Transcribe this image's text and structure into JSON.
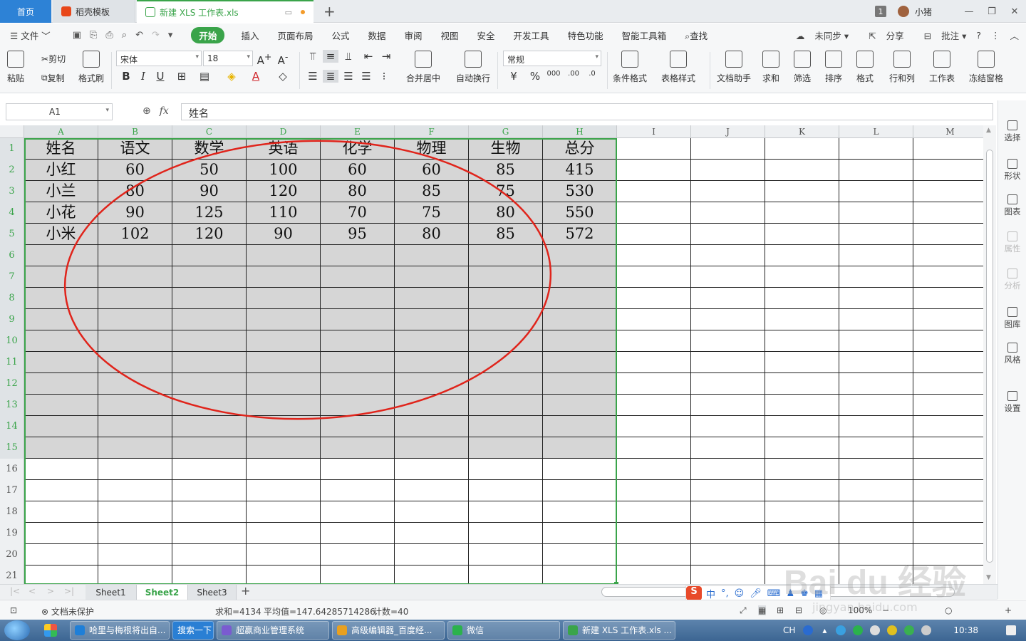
{
  "titlebar": {
    "tabs": [
      {
        "label": "首页"
      },
      {
        "label": "稻壳模板"
      },
      {
        "label": "新建 XLS 工作表.xls"
      }
    ],
    "window_count": "1",
    "user_name": "小猪"
  },
  "menubar": {
    "file_label": "文件",
    "items": [
      "开始",
      "插入",
      "页面布局",
      "公式",
      "数据",
      "审阅",
      "视图",
      "安全",
      "开发工具",
      "特色功能",
      "智能工具箱"
    ],
    "search_label": "查找",
    "right": {
      "sync": "未同步",
      "share": "分享",
      "comment": "批注"
    }
  },
  "ribbon": {
    "paste": "粘贴",
    "cut": "剪切",
    "copy": "复制",
    "format_painter": "格式刷",
    "font_name": "宋体",
    "font_size": "18",
    "merge_center": "合并居中",
    "wrap": "自动换行",
    "number_format": "常规",
    "cond_format": "条件格式",
    "table_style": "表格样式",
    "doc_helper": "文档助手",
    "sum": "求和",
    "filter": "筛选",
    "sort": "排序",
    "format": "格式",
    "row_col": "行和列",
    "worksheet": "工作表",
    "freeze": "冻结窗格"
  },
  "formula_bar": {
    "name_box": "A1",
    "fx_label": "fx",
    "content": "姓名"
  },
  "right_sidebar": [
    {
      "label": "选择",
      "icon": "cursor-icon",
      "enabled": true
    },
    {
      "label": "形状",
      "icon": "shape-icon",
      "enabled": true
    },
    {
      "label": "图表",
      "icon": "chart-icon",
      "enabled": true
    },
    {
      "label": "属性",
      "icon": "property-icon",
      "enabled": false
    },
    {
      "label": "分析",
      "icon": "analysis-icon",
      "enabled": false
    },
    {
      "label": "图库",
      "icon": "gallery-icon",
      "enabled": true
    },
    {
      "label": "风格",
      "icon": "style-icon",
      "enabled": true
    },
    {
      "label": "设置",
      "icon": "settings-icon",
      "enabled": true
    }
  ],
  "spreadsheet": {
    "columns": [
      "A",
      "B",
      "C",
      "D",
      "E",
      "F",
      "G",
      "H",
      "I",
      "J",
      "K",
      "L",
      "M"
    ],
    "row_count": 21,
    "data": [
      [
        "姓名",
        "语文",
        "数学",
        "英语",
        "化学",
        "物理",
        "生物",
        "总分"
      ],
      [
        "小红",
        "60",
        "50",
        "100",
        "60",
        "60",
        "85",
        "415"
      ],
      [
        "小兰",
        "80",
        "90",
        "120",
        "80",
        "85",
        "75",
        "530"
      ],
      [
        "小花",
        "90",
        "125",
        "110",
        "70",
        "75",
        "80",
        "550"
      ],
      [
        "小米",
        "102",
        "120",
        "90",
        "95",
        "80",
        "85",
        "572"
      ]
    ],
    "selection": {
      "cols": 8,
      "rows": 15
    },
    "annotation_color": "#e0241b",
    "selection_color": "#3aa44a"
  },
  "sheets": {
    "tabs": [
      "Sheet1",
      "Sheet2",
      "Sheet3"
    ],
    "active": "Sheet2"
  },
  "statusbar": {
    "protect": "文档未保护",
    "sum": "求和=4134",
    "avg": "平均值=147.64285714286",
    "count": "计数=40",
    "zoom": "100%"
  },
  "taskbar": {
    "tasks": [
      {
        "label": "哈里与梅根将出自...",
        "color": "#1e7fd8"
      },
      {
        "label": "搜索一下",
        "color": "#2a7fd4"
      },
      {
        "label": "超赢商业管理系统",
        "color": "#7a5bd0"
      },
      {
        "label": "高级编辑器_百度经...",
        "color": "#e8a020"
      },
      {
        "label": "微信",
        "color": "#2bb24c"
      },
      {
        "label": "新建 XLS 工作表.xls ...",
        "color": "#3aa44a"
      }
    ],
    "lang": "CH",
    "time": "10:38"
  },
  "ime": {
    "mode": "中",
    "punct": "°,"
  },
  "watermark": {
    "brand": "Bai du 经验",
    "url": "jingyan.baidu.com"
  }
}
